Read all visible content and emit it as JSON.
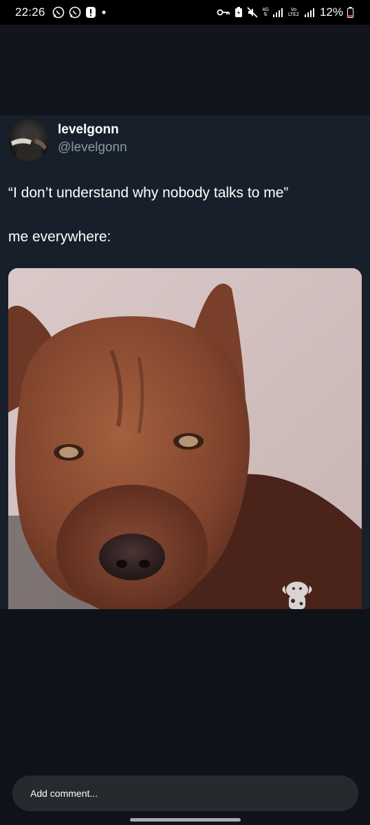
{
  "status_bar": {
    "time": "22:26",
    "battery": "12%",
    "network_label_4g": "4G",
    "network_label_volte": "Vo LTE2",
    "icons": [
      "whatsapp-icon",
      "whatsapp-business-icon",
      "alert-icon",
      "dot-icon",
      "key-icon",
      "battery-saver-icon",
      "mute-icon",
      "signal-icon",
      "signal-icon",
      "battery-icon"
    ]
  },
  "tweet": {
    "author_name": "levelgonn",
    "author_handle": "@levelgonn",
    "text_line_1": "“I don’t understand why nobody talks to me”",
    "text_line_2": "me everywhere:",
    "media_description_icon": "dog-photo"
  },
  "comment": {
    "placeholder": "Add comment..."
  },
  "colors": {
    "background": "#0f1218",
    "card": "#17202a",
    "handle": "#8b98a5",
    "comment_bar": "#26292e"
  }
}
